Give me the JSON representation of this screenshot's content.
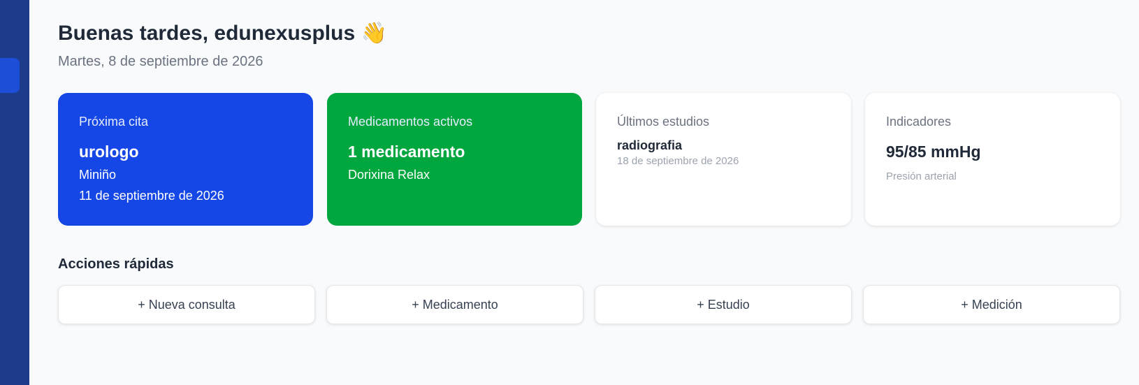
{
  "header": {
    "greeting": "Buenas tardes, edunexusplus 👋",
    "date": "Martes, 8 de septiembre de 2026"
  },
  "cards": {
    "next_appointment": {
      "label": "Próxima cita",
      "value": "urologo",
      "doctor": "Miniño",
      "date": "11 de septiembre de 2026",
      "color": "#1547e6"
    },
    "active_medications": {
      "label": "Medicamentos activos",
      "value": "1 medicamento",
      "item": "Dorixina Relax",
      "color": "#00a63e"
    },
    "latest_studies": {
      "label": "Últimos estudios",
      "name": "radiografia",
      "date": "18 de septiembre de 2026"
    },
    "indicators": {
      "label": "Indicadores",
      "value": "95/85 mmHg",
      "caption": "Presión arterial"
    }
  },
  "quick_actions": {
    "title": "Acciones rápidas",
    "buttons": [
      {
        "label": "+ Nueva consulta"
      },
      {
        "label": "+ Medicamento"
      },
      {
        "label": "+ Estudio"
      },
      {
        "label": "+ Medición"
      }
    ]
  },
  "colors": {
    "sidebar": "#1e3a8a",
    "sidebar_active": "#1d4ed8"
  }
}
